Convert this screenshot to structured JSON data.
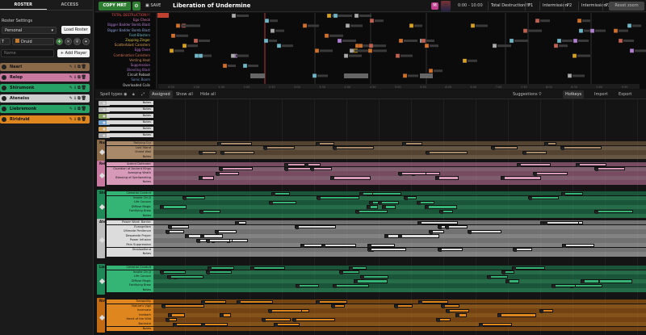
{
  "sidebar": {
    "tabs": [
      "ROSTER",
      "ACCESS"
    ],
    "roster_settings_label": "Roster Settings",
    "roster_select": "Personal",
    "load_roster": "Load Roster",
    "tank_select": "T",
    "class_select": "Druid",
    "name_placeholder": "Name",
    "add_player": "+ Add Player",
    "players": [
      {
        "name": "Naari",
        "color": "#8b6a4a"
      },
      {
        "name": "Relop",
        "color": "#c9799f"
      },
      {
        "name": "Shirumonk",
        "color": "#27a267"
      },
      {
        "name": "Ateneiss",
        "color": "#cfcfcf"
      },
      {
        "name": "Liebremonk",
        "color": "#27a267"
      },
      {
        "name": "Riridruid",
        "color": "#e0861f"
      }
    ]
  },
  "topbar": {
    "copy_mrt": "COPY MRT",
    "save": "SAVE",
    "title": "Liberation of Undermine",
    "difficulty": "M",
    "time_range": "0:00 - 10:00",
    "phases": [
      "Total Destruction!!!",
      "P1",
      "Intermission",
      "P2",
      "Intermission",
      "P2"
    ],
    "reset_zoom": "Reset zoom"
  },
  "timeline": {
    "abilities": [
      {
        "name": "TOTAL DESTRUCTION!!!",
        "color": "#e05050"
      },
      {
        "name": "Ego Check",
        "color": "#d67ab5"
      },
      {
        "name": "Bigger Badder Bomb Blast",
        "color": "#b07fd0"
      },
      {
        "name": "Bigger Badder Bomb Blast",
        "color": "#8aa0d8"
      },
      {
        "name": "Foot-Blasters",
        "color": "#6fb7c7"
      },
      {
        "name": "Zapping Zinger",
        "color": "#d8c040"
      },
      {
        "name": "Scatterblast Canisters",
        "color": "#e0a050"
      },
      {
        "name": "Egg Oven",
        "color": "#c06fd0"
      },
      {
        "name": "Combination Canisters",
        "color": "#d07050"
      },
      {
        "name": "Venting Heat",
        "color": "#c88a5a"
      },
      {
        "name": "Suppression",
        "color": "#c07ad0"
      },
      {
        "name": "Bleeding Blast",
        "color": "#a070c0"
      },
      {
        "name": "Circuit Reboot",
        "color": "#dddddd"
      },
      {
        "name": "Sonic Boom",
        "color": "#7090c0"
      },
      {
        "name": "Overloaded Coils",
        "color": "#dddddd"
      }
    ],
    "axis_ticks": [
      "0:30",
      "1:00",
      "1:30",
      "2:00",
      "2:30",
      "3:00",
      "3:30",
      "4:00",
      "4:30",
      "5:00",
      "5:30",
      "6:00",
      "6:30",
      "7:00",
      "7:30",
      "8:00",
      "8:30",
      "9:00",
      "9:30"
    ]
  },
  "toolbar": {
    "spell_types": "Spell types",
    "assigned": "Assigned",
    "show_all": "Show all",
    "hide_all": "Hide all",
    "suggestions": "Suggestions",
    "hotkeys": "Hotkeys",
    "import": "Import",
    "export": "Export"
  },
  "raid_cds": {
    "note_label": "Notes",
    "rows": [
      {
        "color": "#bbbbbb"
      },
      {
        "color": "#bbbbbb"
      },
      {
        "color": "#88a060"
      },
      {
        "color": "#6fa0d0"
      },
      {
        "color": "#d0a060"
      },
      {
        "color": "#aaaaaa"
      }
    ]
  },
  "sections": [
    {
      "tag": "Naari",
      "color": "#8b6a4a",
      "light": "#a88a6a",
      "spells": [
        "Rallying Cry",
        "Last Stand",
        "Shield Wall",
        "Notes"
      ]
    },
    {
      "tag": "Relop",
      "color": "#c9799f",
      "light": "#d69ab8",
      "spells": [
        "Ardent Defender",
        "Guardian of Ancient Kings",
        "Avenging Wrath",
        "Blessing of Spellwarding",
        "Notes"
      ]
    },
    {
      "tag": "Shiru",
      "color": "#1f8a57",
      "light": "#35b575",
      "spells": [
        "Celestial Conduit",
        "Invoke Chi-Ji",
        "Life Cocoon",
        "Diffuse Magic",
        "Fortifying Brew",
        "Notes"
      ]
    },
    {
      "tag": "Aten",
      "color": "#bdbdbd",
      "light": "#dcdcdc",
      "spells": [
        "Power Word: Barrier",
        "Evangelism",
        "Ultimate Penitence",
        "Desperate Prayer",
        "Power Infusion",
        "Pain Suppression",
        "Shadowfiend",
        "Notes"
      ]
    },
    {
      "tag": "Lieb",
      "color": "#1f8a57",
      "light": "#35b575",
      "spells": [
        "Celestial Conduit",
        "Invoke Chi-Ji",
        "Life Cocoon",
        "Diffuse Magic",
        "Fortifying Brew",
        "Notes"
      ]
    },
    {
      "tag": "Riri",
      "color": "#c36a14",
      "light": "#e0861f",
      "spells": [
        "Tranquility",
        "Nature's Vigil",
        "Innervate",
        "Ironbark",
        "Heart of the Wild",
        "Barkskin",
        "Notes"
      ]
    }
  ]
}
